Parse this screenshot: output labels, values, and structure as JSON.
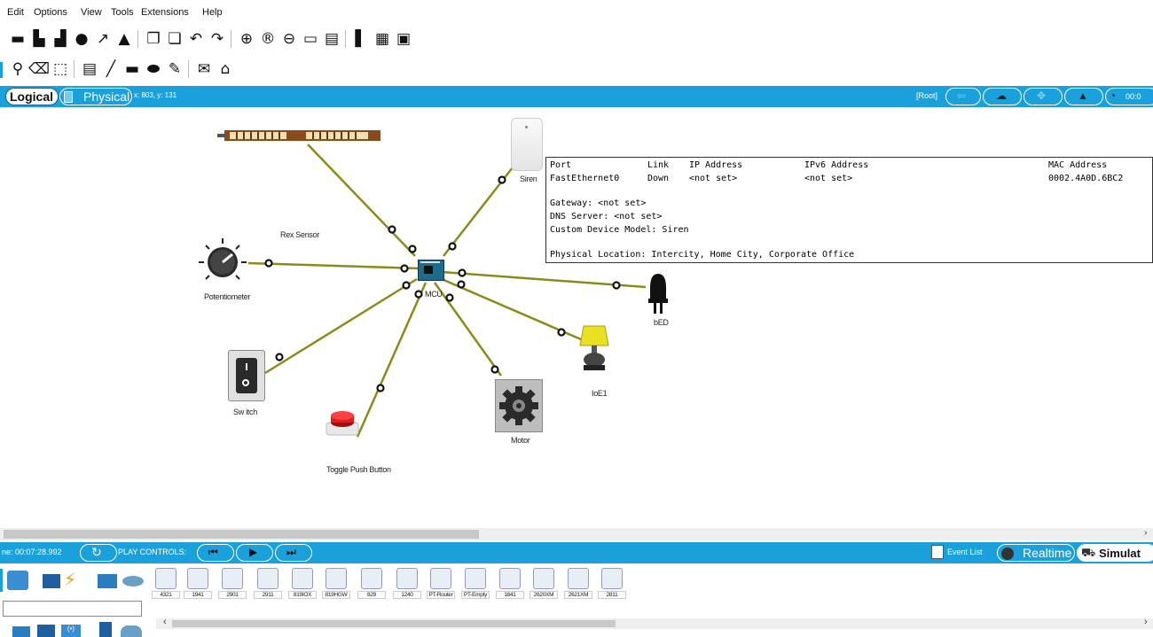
{
  "menu": [
    "Edit",
    "Options",
    "View",
    "Tools",
    "Extensions",
    "Help"
  ],
  "toolbar_main_icons": [
    "folder-open-icon",
    "save-icon",
    "print-icon",
    "info-icon",
    "network-wizard-icon",
    "activity-wizard-icon",
    "copy-icon",
    "paste-icon",
    "undo-icon",
    "redo-icon",
    "zoom-in-icon",
    "zoom-reset-icon",
    "zoom-out-icon",
    "drawing-palette-icon",
    "custom-device-icon",
    "pdu-list-icon",
    "device-list-icon",
    "screenshot-icon"
  ],
  "toolbar_draw_icons": [
    "inspect-icon",
    "delete-icon",
    "resize-icon",
    "note-icon",
    "line-icon",
    "rectangle-icon",
    "ellipse-icon",
    "freeform-icon",
    "simple-pdu-icon",
    "complex-pdu-icon"
  ],
  "view_bar": {
    "logical_label": "Logical",
    "physical_label": "Physical",
    "coords": "x: 803, y: 131",
    "root_label": "[Root]",
    "time_label": "00:0"
  },
  "workspace": {
    "devices": [
      {
        "name": "Siren"
      },
      {
        "name": "Rex Sensor"
      },
      {
        "name": "Potentiometer"
      },
      {
        "name": "MCU"
      },
      {
        "name": "bED"
      },
      {
        "name": "IoE1"
      },
      {
        "name": "Switch",
        "display": "Sw itch"
      },
      {
        "name": "Motor"
      },
      {
        "name": "Toggle Push Button"
      }
    ]
  },
  "info_popup": {
    "headers": [
      "Port",
      "Link",
      "IP Address",
      "IPv6 Address",
      "MAC Address"
    ],
    "row": [
      "FastEthernet0",
      "Down",
      "<not set>",
      "<not set>",
      "0002.4A0D.6BC2"
    ],
    "gateway": "Gateway:  <not set>",
    "dns": "DNS Server:  <not set>",
    "model": "Custom Device Model: Siren",
    "location": "Physical Location: Intercity, Home City, Corporate Office"
  },
  "sim_bar": {
    "time": "ne: 00:07:28.992",
    "play_controls": "PLAY CONTROLS:",
    "event_list": "Event List",
    "realtime": "Realtime",
    "simulation": "Simulat"
  },
  "device_models": [
    "4321",
    "1941",
    "2901",
    "2911",
    "819IOX",
    "819HGW",
    "829",
    "1240",
    "PT-Router",
    "PT-Empty",
    "1841",
    "2620XM",
    "2621XM",
    "2811"
  ],
  "colors": {
    "accent": "#1aa1dc",
    "cable": "#8b8b1a",
    "lamp": "#e8e020"
  }
}
